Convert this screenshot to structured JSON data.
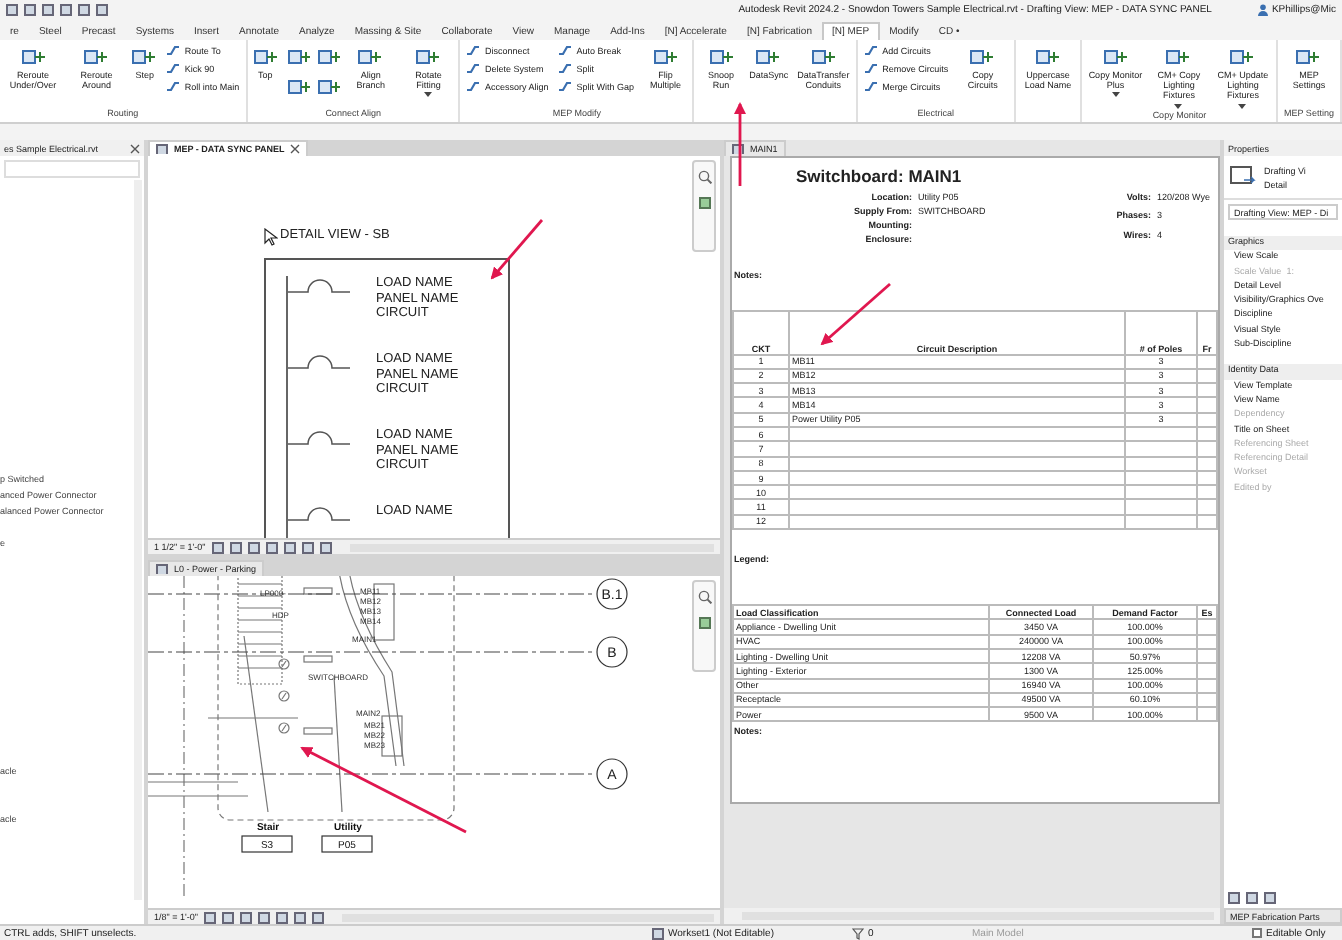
{
  "window": {
    "title": "Autodesk Revit 2024.2 - Snowdon Towers Sample Electrical.rvt - Drafting View: MEP - DATA SYNC PANEL",
    "user": "KPhillips@Mic"
  },
  "tabs": [
    {
      "label": "re",
      "selected": false
    },
    {
      "label": "Steel",
      "selected": false
    },
    {
      "label": "Precast",
      "selected": false
    },
    {
      "label": "Systems",
      "selected": false
    },
    {
      "label": "Insert",
      "selected": false
    },
    {
      "label": "Annotate",
      "selected": false
    },
    {
      "label": "Analyze",
      "selected": false
    },
    {
      "label": "Massing & Site",
      "selected": false
    },
    {
      "label": "Collaborate",
      "selected": false
    },
    {
      "label": "View",
      "selected": false
    },
    {
      "label": "Manage",
      "selected": false
    },
    {
      "label": "Add-Ins",
      "selected": false
    },
    {
      "label": "[N] Accelerate",
      "selected": false
    },
    {
      "label": "[N] Fabrication",
      "selected": false
    },
    {
      "label": "[N] MEP",
      "selected": true
    },
    {
      "label": "Modify",
      "selected": false
    },
    {
      "label": "CD •",
      "selected": false
    }
  ],
  "ribbon": {
    "panels": [
      {
        "label": "Routing",
        "items": [
          {
            "kind": "large",
            "label": "Reroute Under/Over",
            "dropdown": false
          },
          {
            "kind": "large",
            "label": "Reroute Around",
            "dropdown": false
          },
          {
            "kind": "large",
            "label": "Step",
            "dropdown": false
          },
          {
            "kind": "stack",
            "labels": [
              "Route To",
              "Kick 90",
              "Roll into Main"
            ]
          }
        ]
      },
      {
        "label": "Connect Align",
        "items": [
          {
            "kind": "large",
            "label": "Top",
            "dropdown": false
          },
          {
            "kind": "icons"
          },
          {
            "kind": "icons"
          },
          {
            "kind": "large",
            "label": "Align Branch",
            "dropdown": false
          },
          {
            "kind": "large",
            "label": "Rotate Fitting",
            "dropdown": true
          }
        ]
      },
      {
        "label": "MEP Modify",
        "items": [
          {
            "kind": "stack",
            "labels": [
              "Disconnect",
              "Delete System",
              "Accessory Align"
            ]
          },
          {
            "kind": "stack",
            "labels": [
              "Auto Break",
              "Split",
              "Split With Gap"
            ]
          },
          {
            "kind": "large",
            "label": "Flip Multiple",
            "dropdown": false
          }
        ]
      },
      {
        "items": [
          {
            "kind": "large",
            "label": "Snoop Run",
            "dropdown": false
          },
          {
            "kind": "large",
            "label": "DataSync",
            "dropdown": false
          },
          {
            "kind": "large",
            "label": "DataTransfer Conduits",
            "dropdown": false
          }
        ]
      },
      {
        "label": "Electrical",
        "items": [
          {
            "kind": "stack",
            "labels": [
              "Add Circuits",
              "Remove Circuits",
              "Merge Circuits"
            ]
          },
          {
            "kind": "large",
            "label": "Copy Circuits",
            "dropdown": false
          }
        ]
      },
      {
        "items": [
          {
            "kind": "large",
            "label": "Uppercase Load Name",
            "dropdown": false
          }
        ]
      },
      {
        "label": "Copy Monitor",
        "items": [
          {
            "kind": "large",
            "label": "Copy Monitor Plus",
            "dropdown": true
          },
          {
            "kind": "large",
            "label": "CM+ Copy Lighting Fixtures",
            "dropdown": true
          },
          {
            "kind": "large",
            "label": "CM+ Update Lighting Fixtures",
            "dropdown": true
          }
        ]
      },
      {
        "label": "MEP Setting",
        "items": [
          {
            "kind": "large",
            "label": "MEP Settings",
            "dropdown": false
          }
        ]
      }
    ]
  },
  "project_browser": {
    "title": "es Sample Electrical.rvt",
    "items": [
      "p Switched",
      "anced Power Connector",
      "alanced Power Connector",
      "e",
      "acle",
      "acle"
    ]
  },
  "detail_view": {
    "tab": "MEP - DATA SYNC PANEL",
    "title": "DETAIL VIEW - SB",
    "entries": [
      {
        "lines": [
          "LOAD NAME",
          "PANEL NAME",
          "CIRCUIT"
        ]
      },
      {
        "lines": [
          "LOAD NAME",
          "PANEL NAME",
          "CIRCUIT"
        ]
      },
      {
        "lines": [
          "LOAD NAME",
          "PANEL NAME",
          "CIRCUIT"
        ]
      },
      {
        "lines": [
          "LOAD NAME"
        ]
      }
    ],
    "scale": "1 1/2\" = 1'-0\""
  },
  "plan_view": {
    "tab": "L0 - Power - Parking",
    "grids": [
      "B.1",
      "B",
      "A"
    ],
    "tags": [
      "LP000-",
      "HDP",
      "MB11",
      "MB12",
      "MB13",
      "MB14",
      "MAIN1",
      "SWITCHBOARD",
      "MAIN2",
      "MB21",
      "MB22",
      "MB23"
    ],
    "rooms": [
      {
        "name": "Stair",
        "number": "S3"
      },
      {
        "name": "Utility",
        "number": "P05"
      }
    ],
    "scale": "1/8\" = 1'-0\""
  },
  "schedule": {
    "tab": "MAIN1",
    "title": "Switchboard: MAIN1",
    "info_left": [
      {
        "label": "Location:",
        "value": "Utility P05"
      },
      {
        "label": "Supply From:",
        "value": "SWITCHBOARD"
      },
      {
        "label": "Mounting:"
      },
      {
        "label": "Enclosure:"
      }
    ],
    "info_right": [
      {
        "label": "Volts:",
        "value": "120/208 Wye"
      },
      {
        "label": "Phases:",
        "value": "3"
      },
      {
        "label": "Wires:",
        "value": "4"
      }
    ],
    "notes_label": "Notes:",
    "circuits": {
      "columns": [
        "CKT",
        "Circuit Description",
        "# of Poles",
        "Fr"
      ],
      "rows": [
        {
          "ckt": "1",
          "description": "MB11",
          "poles": "3"
        },
        {
          "ckt": "2",
          "description": "MB12",
          "poles": "3"
        },
        {
          "ckt": "3",
          "description": "MB13",
          "poles": "3"
        },
        {
          "ckt": "4",
          "description": "MB14",
          "poles": "3"
        },
        {
          "ckt": "5",
          "description": "Power Utility P05",
          "poles": "3"
        },
        {
          "ckt": "6"
        },
        {
          "ckt": "7"
        },
        {
          "ckt": "8"
        },
        {
          "ckt": "9"
        },
        {
          "ckt": "10"
        },
        {
          "ckt": "11"
        },
        {
          "ckt": "12"
        }
      ]
    },
    "legend_label": "Legend:",
    "loads": {
      "columns": [
        "Load Classification",
        "Connected Load",
        "Demand Factor",
        "Es"
      ],
      "rows": [
        {
          "classification": "Appliance - Dwelling Unit",
          "connected": "3450 VA",
          "demand": "100.00%"
        },
        {
          "classification": "HVAC",
          "connected": "240000 VA",
          "demand": "100.00%"
        },
        {
          "classification": "Lighting - Dwelling Unit",
          "connected": "12208 VA",
          "demand": "50.97%"
        },
        {
          "classification": "Lighting - Exterior",
          "connected": "1300 VA",
          "demand": "125.00%"
        },
        {
          "classification": "Other",
          "connected": "16940 VA",
          "demand": "100.00%"
        },
        {
          "classification": "Receptacle",
          "connected": "49500 VA",
          "demand": "60.10%"
        },
        {
          "classification": "Power",
          "connected": "9500 VA",
          "demand": "100.00%"
        }
      ]
    },
    "footer_notes_label": "Notes:"
  },
  "properties": {
    "title": "Properties",
    "type_name": "Drafting Vi",
    "type_sub": "Detail",
    "selector": "Drafting View: MEP - Di",
    "groups": [
      {
        "name": "Graphics",
        "rows": [
          {
            "name": "View Scale",
            "disabled": false
          },
          {
            "name": "Scale Value",
            "value": "1:",
            "disabled": true
          },
          {
            "name": "Detail Level",
            "disabled": false
          },
          {
            "name": "Visibility/Graphics Ove",
            "disabled": false
          },
          {
            "name": "Discipline",
            "disabled": false
          },
          {
            "name": "Visual Style",
            "disabled": false
          },
          {
            "name": "Sub-Discipline",
            "disabled": false
          }
        ]
      },
      {
        "name": "Identity Data",
        "rows": [
          {
            "name": "View Template",
            "disabled": false
          },
          {
            "name": "View Name",
            "disabled": false
          },
          {
            "name": "Dependency",
            "disabled": true
          },
          {
            "name": "Title on Sheet",
            "disabled": false
          },
          {
            "name": "Referencing Sheet",
            "disabled": true
          },
          {
            "name": "Referencing Detail",
            "disabled": true
          },
          {
            "name": "Workset",
            "disabled": true
          },
          {
            "name": "Edited by",
            "disabled": true
          }
        ]
      }
    ],
    "bottom_tab": "MEP Fabrication Parts"
  },
  "status": {
    "hint": "CTRL adds, SHIFT unselects.",
    "workset": "Workset1 (Not Editable)",
    "count": "0",
    "model": "Main Model",
    "editable_only": {
      "label": "Editable Only",
      "checked": false
    }
  }
}
